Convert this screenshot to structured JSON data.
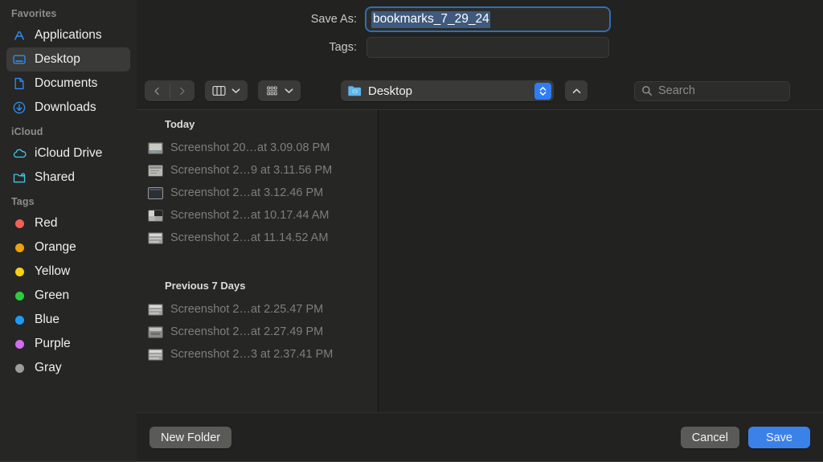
{
  "sidebar": {
    "groups": [
      {
        "title": "Favorites",
        "items": [
          {
            "label": "Applications",
            "icon": "applications-icon",
            "selected": false
          },
          {
            "label": "Desktop",
            "icon": "desktop-icon",
            "selected": true
          },
          {
            "label": "Documents",
            "icon": "document-icon",
            "selected": false
          },
          {
            "label": "Downloads",
            "icon": "downloads-icon",
            "selected": false
          }
        ]
      },
      {
        "title": "iCloud",
        "items": [
          {
            "label": "iCloud Drive",
            "icon": "cloud-icon",
            "selected": false
          },
          {
            "label": "Shared",
            "icon": "shared-folder-icon",
            "selected": false
          }
        ]
      }
    ],
    "tags_title": "Tags",
    "tags": [
      {
        "label": "Red",
        "color": "#f45f58"
      },
      {
        "label": "Orange",
        "color": "#f0a00f"
      },
      {
        "label": "Yellow",
        "color": "#f5d112"
      },
      {
        "label": "Green",
        "color": "#2fcb3f"
      },
      {
        "label": "Blue",
        "color": "#1b9bf6"
      },
      {
        "label": "Purple",
        "color": "#d06ef0"
      },
      {
        "label": "Gray",
        "color": "#9d9d9b"
      }
    ]
  },
  "form": {
    "save_as_label": "Save As:",
    "save_as_value": "bookmarks_7_29_24",
    "tags_label": "Tags:",
    "tags_value": ""
  },
  "toolbar": {
    "back_icon": "chevron-left-icon",
    "forward_icon": "chevron-right-icon",
    "view_icon": "column-view-icon",
    "group_icon": "group-by-icon",
    "path_label": "Desktop",
    "up_icon": "chevron-up-icon",
    "search_placeholder": "Search",
    "search_value": ""
  },
  "browser": {
    "groups": [
      {
        "header": "Today",
        "files": [
          {
            "name": "Screenshot 20…at 3.09.08 PM",
            "thumb": "window-light"
          },
          {
            "name": "Screenshot 2…9 at 3.11.56 PM",
            "thumb": "doc-light"
          },
          {
            "name": "Screenshot 2…at 3.12.46 PM",
            "thumb": "window-dark"
          },
          {
            "name": "Screenshot 2…at 10.17.44 AM",
            "thumb": "split-dark"
          },
          {
            "name": "Screenshot 2…at 11.14.52 AM",
            "thumb": "bar-light"
          }
        ]
      },
      {
        "header": "Previous 7 Days",
        "files": [
          {
            "name": "Screenshot 2…at 2.25.47 PM",
            "thumb": "bar-light"
          },
          {
            "name": "Screenshot 2…at 2.27.49 PM",
            "thumb": "bar-light"
          },
          {
            "name": "Screenshot 2…3 at 2.37.41 PM",
            "thumb": "bar-light"
          }
        ]
      }
    ]
  },
  "footer": {
    "new_folder_label": "New Folder",
    "cancel_label": "Cancel",
    "save_label": "Save"
  },
  "colors": {
    "accent": "#3b82e8",
    "sidebar_icon": "#2f8cf0",
    "icloud_icon": "#3fc8e4",
    "selection": "#3f5a7d"
  }
}
